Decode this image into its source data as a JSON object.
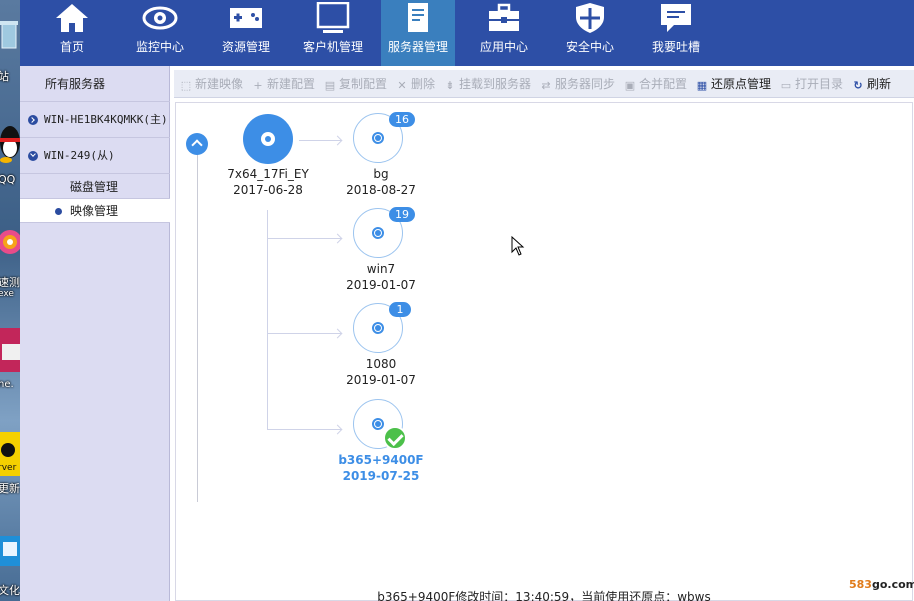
{
  "desktop": {
    "labels": [
      "站",
      "QQ",
      "速测",
      "exe",
      "ne.",
      "rver",
      "更新",
      "文化"
    ]
  },
  "top_nav": {
    "items": [
      {
        "label": "首页",
        "icon": "home-icon"
      },
      {
        "label": "监控中心",
        "icon": "eye-icon"
      },
      {
        "label": "资源管理",
        "icon": "gamepad-icon"
      },
      {
        "label": "客户机管理",
        "icon": "monitor-icon"
      },
      {
        "label": "服务器管理",
        "icon": "document-icon",
        "active": true
      },
      {
        "label": "应用中心",
        "icon": "toolbox-icon"
      },
      {
        "label": "安全中心",
        "icon": "shield-icon"
      },
      {
        "label": "我要吐槽",
        "icon": "chat-icon"
      }
    ]
  },
  "sidebar": {
    "title": "所有服务器",
    "servers": [
      {
        "label": "WIN-HE1BK4KQMKK(主)",
        "expanded": false
      },
      {
        "label": "WIN-249(从)",
        "expanded": true
      }
    ],
    "subitems": [
      {
        "label": "磁盘管理",
        "selected": false
      },
      {
        "label": "映像管理",
        "selected": true
      }
    ]
  },
  "actions": [
    {
      "label": "新建映像",
      "icon": "new-image-icon",
      "enabled": false
    },
    {
      "label": "新建配置",
      "icon": "plus-icon",
      "enabled": false
    },
    {
      "label": "复制配置",
      "icon": "copy-icon",
      "enabled": false
    },
    {
      "label": "删除",
      "icon": "delete-icon",
      "enabled": false
    },
    {
      "label": "挂载到服务器",
      "icon": "mount-icon",
      "enabled": false
    },
    {
      "label": "服务器同步",
      "icon": "sync-icon",
      "enabled": false
    },
    {
      "label": "合并配置",
      "icon": "merge-icon",
      "enabled": false
    },
    {
      "label": "还原点管理",
      "icon": "restore-icon",
      "enabled": true
    },
    {
      "label": "打开目录",
      "icon": "folder-icon",
      "enabled": false
    },
    {
      "label": "刷新",
      "icon": "refresh-icon",
      "enabled": true
    }
  ],
  "tree": {
    "root": {
      "name": "7x64_17Fi_EY",
      "date": "2017-06-28"
    },
    "children": [
      {
        "name": "bg",
        "date": "2018-08-27",
        "badge": "16"
      },
      {
        "name": "win7",
        "date": "2019-01-07",
        "badge": "19"
      },
      {
        "name": "1080",
        "date": "2019-01-07",
        "badge": "1"
      },
      {
        "name": "b365+9400F",
        "date": "2019-07-25",
        "active": true
      }
    ]
  },
  "status_bar": "b365+9400F修改时间：13:40:59，当前使用还原点：wbws",
  "watermark": {
    "prefix": "583",
    "suffix": "go.com"
  },
  "colors": {
    "nav_bg": "#2d4fa6",
    "nav_active": "#3a7fbe",
    "accent": "#3d8ee6",
    "check": "#4cc04a"
  }
}
